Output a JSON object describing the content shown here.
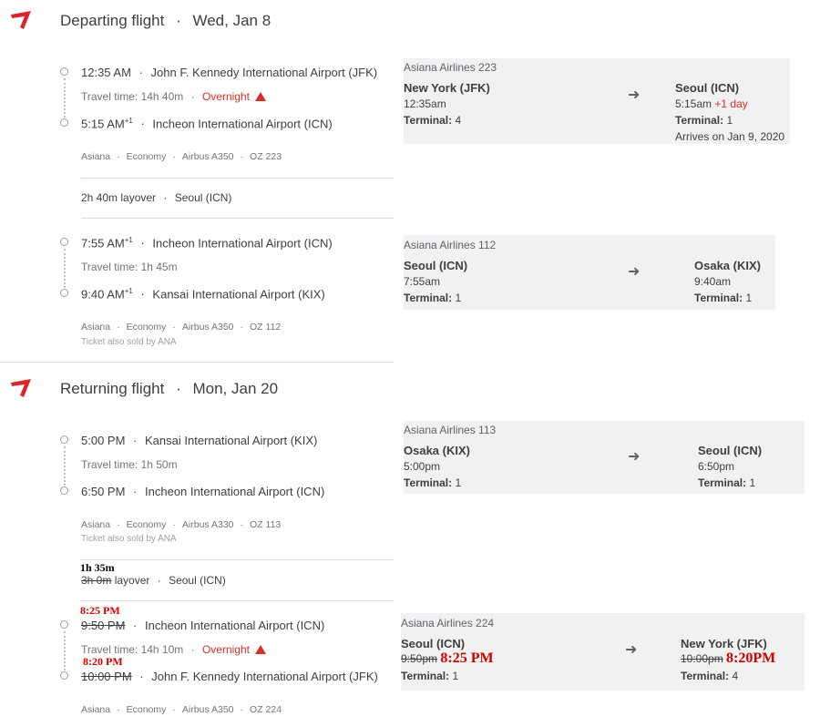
{
  "departing": {
    "title": "Departing flight",
    "date": "Wed, Jan 8",
    "leg1": {
      "dep_time": "12:35 AM",
      "dep_airport": "John F. Kennedy International Airport (JFK)",
      "travel_time": "Travel time: 14h 40m",
      "overnight": "Overnight",
      "arr_time": "5:15 AM",
      "arr_sup": "+1",
      "arr_airport": "Incheon International Airport (ICN)",
      "meta": [
        "Asiana",
        "Economy",
        "Airbus A350",
        "OZ 223"
      ]
    },
    "layover": {
      "duration": "2h 40m layover",
      "place": "Seoul (ICN)"
    },
    "leg2": {
      "dep_time": "7:55 AM",
      "dep_sup": "+1",
      "dep_airport": "Incheon International Airport (ICN)",
      "travel_time": "Travel time: 1h 45m",
      "arr_time": "9:40 AM",
      "arr_sup": "+1",
      "arr_airport": "Kansai International Airport (KIX)",
      "meta": [
        "Asiana",
        "Economy",
        "Airbus A350",
        "OZ 112"
      ],
      "sold_by": "Ticket also sold by ANA"
    }
  },
  "returning": {
    "title": "Returning flight",
    "date": "Mon, Jan 20",
    "leg1": {
      "dep_time": "5:00 PM",
      "dep_airport": "Kansai International Airport (KIX)",
      "travel_time": "Travel time: 1h 50m",
      "arr_time": "6:50 PM",
      "arr_airport": "Incheon International Airport (ICN)",
      "meta": [
        "Asiana",
        "Economy",
        "Airbus A330",
        "OZ 113"
      ],
      "sold_by": "Ticket also sold by ANA"
    },
    "layover": {
      "handwritten": "1h 35m",
      "old_duration": "3h 0m",
      "suffix": "layover",
      "place": "Seoul (ICN)"
    },
    "leg2": {
      "dep_new": "8:25 PM",
      "dep_old": "9:50 PM",
      "dep_airport": "Incheon International Airport (ICN)",
      "travel_time": "Travel time: 14h 10m",
      "overnight": "Overnight",
      "arr_new": "8:20 PM",
      "arr_old": "10:00 PM",
      "arr_airport": "John F. Kennedy International Airport (JFK)",
      "meta": [
        "Asiana",
        "Economy",
        "Airbus A350",
        "OZ 224"
      ]
    }
  },
  "cards": [
    {
      "airline": "Asiana Airlines 223",
      "from_city": "New York (JFK)",
      "from_time": "12:35am",
      "from_terminal": "4",
      "to_city": "Seoul (ICN)",
      "to_time": "5:15am",
      "to_plus": "+1 day",
      "to_terminal": "1",
      "arrives_note": "Arrives on Jan 9, 2020"
    },
    {
      "airline": "Asiana Airlines 112",
      "from_city": "Seoul (ICN)",
      "from_time": "7:55am",
      "from_terminal": "1",
      "to_city": "Osaka (KIX)",
      "to_time": "9:40am",
      "to_terminal": "1"
    },
    {
      "airline": "Asiana Airlines 113",
      "from_city": "Osaka (KIX)",
      "from_time": "5:00pm",
      "from_terminal": "1",
      "to_city": "Seoul (ICN)",
      "to_time": "6:50pm",
      "to_terminal": "1"
    },
    {
      "airline": "Asiana Airlines 224",
      "from_city": "Seoul (ICN)",
      "from_old_time": "9:50pm",
      "from_new_time": "8:25 PM",
      "from_terminal": "1",
      "to_city": "New York (JFK)",
      "to_old_time": "10:00pm",
      "to_new_time": "8:20PM",
      "to_terminal": "4"
    }
  ],
  "labels": {
    "terminal": "Terminal:",
    "arrow": "➜",
    "dot_sep": "·"
  },
  "colors": {
    "accent": "#d93025",
    "card_bg": "#f1f1f1",
    "handwritten_red": "#d40000"
  },
  "icons": {
    "airline_logo": "asiana-logo",
    "warning": "warning-icon",
    "arrow": "arrow-right-icon"
  }
}
